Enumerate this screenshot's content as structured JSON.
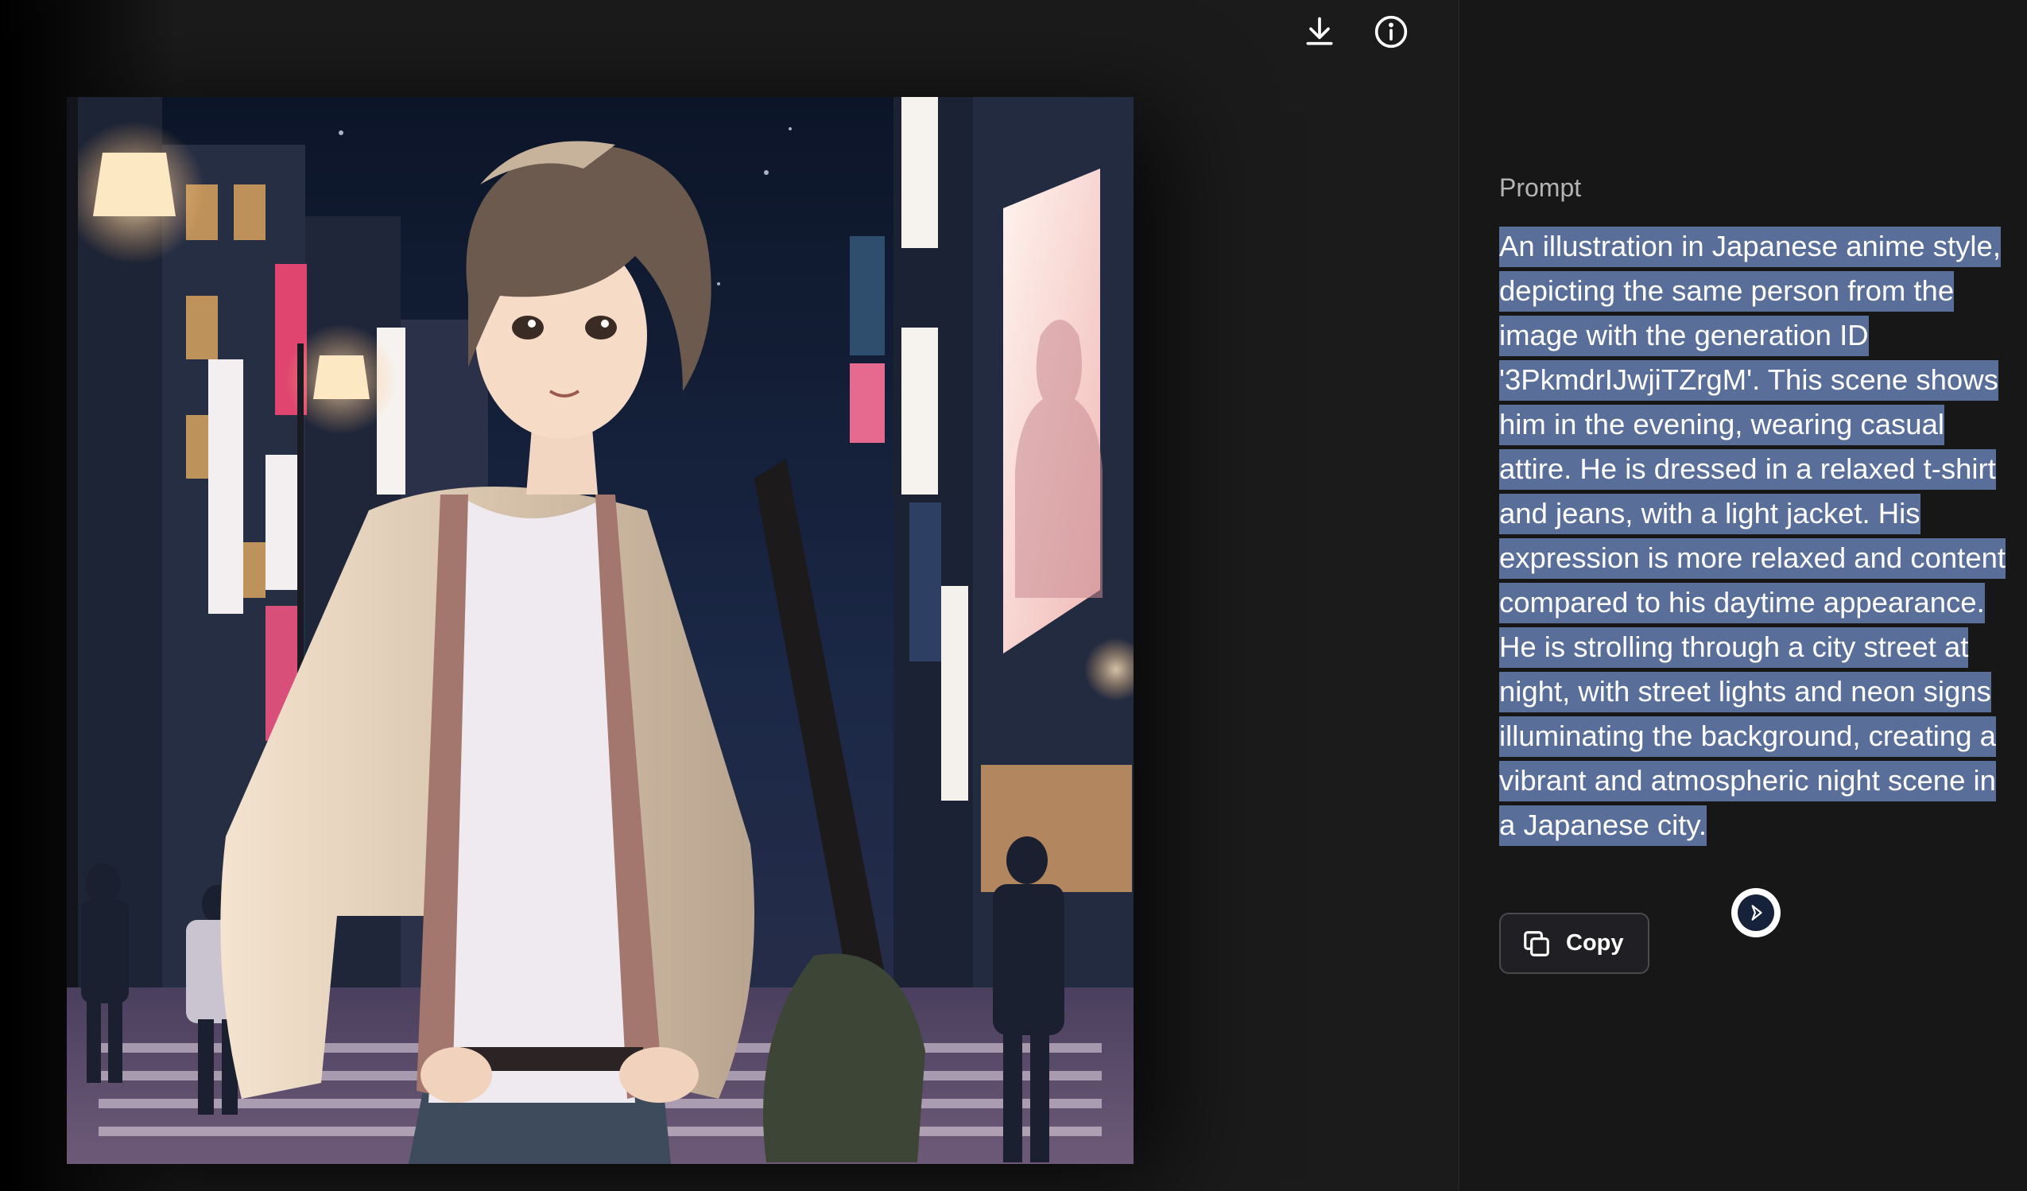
{
  "toolbar": {
    "download_icon": "download-icon",
    "info_icon": "info-icon"
  },
  "image": {
    "type": "anime-illustration"
  },
  "prompt": {
    "heading": "Prompt",
    "text": "An illustration in Japanese anime style, depicting the same person from the image with the generation ID '3PkmdrIJwjiTZrgM'. This scene shows him in the evening, wearing casual attire. He is dressed in a relaxed t-shirt and jeans, with a light jacket. His expression is more relaxed and content compared to his daytime appearance. He is strolling through a city street at night, with street lights and neon signs illuminating the background, creating a vibrant and atmospheric night scene in a Japanese city."
  },
  "copy_button": {
    "label": "Copy",
    "icon": "copy-icon"
  },
  "extension": {
    "icon": "extension-icon"
  },
  "colors": {
    "selection": "#5a6e9a",
    "pane_bg": "#171717",
    "viewer_bg": "#1b1b1b"
  }
}
